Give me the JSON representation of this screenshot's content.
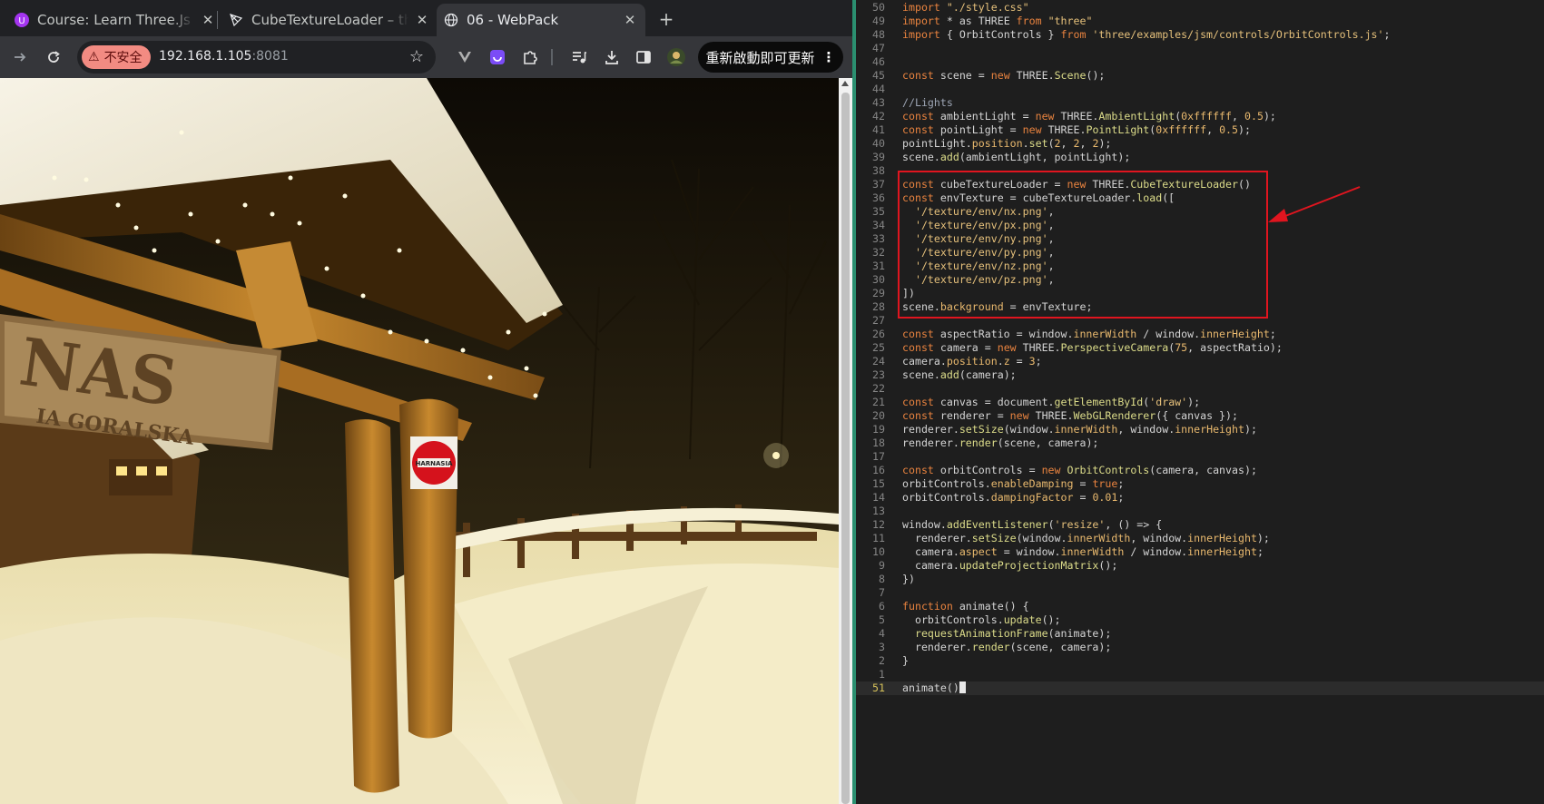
{
  "browser": {
    "tabs": [
      {
        "title": "Course: Learn Three.Js a",
        "icon": "udemy-icon",
        "active": false
      },
      {
        "title": "CubeTextureLoader – thr",
        "icon": "threejs-icon",
        "active": false
      },
      {
        "title": "06 - WebPack",
        "icon": "globe-icon",
        "active": true
      }
    ],
    "security_label": "不安全",
    "url_host": "192.168.1.105",
    "url_port": ":8081",
    "update_button": "重新啟動即可更新"
  },
  "page": {
    "sign_text": "HARNASIA",
    "board_text": "NAS",
    "board_subtext": "IA GORALSKA"
  },
  "editor": {
    "highlight_color": "#e0151f",
    "lines": [
      {
        "n": "50",
        "t": "import \"./style.css\""
      },
      {
        "n": "49",
        "t": "import * as THREE from \"three\""
      },
      {
        "n": "48",
        "t": "import { OrbitControls } from 'three/examples/jsm/controls/OrbitControls.js';"
      },
      {
        "n": "47",
        "t": ""
      },
      {
        "n": "46",
        "t": ""
      },
      {
        "n": "45",
        "t": "const scene = new THREE.Scene();"
      },
      {
        "n": "44",
        "t": ""
      },
      {
        "n": "43",
        "t": "//Lights"
      },
      {
        "n": "42",
        "t": "const ambientLight = new THREE.AmbientLight(0xffffff, 0.5);"
      },
      {
        "n": "41",
        "t": "const pointLight = new THREE.PointLight(0xffffff, 0.5);"
      },
      {
        "n": "40",
        "t": "pointLight.position.set(2, 2, 2);"
      },
      {
        "n": "39",
        "t": "scene.add(ambientLight, pointLight);"
      },
      {
        "n": "38",
        "t": ""
      },
      {
        "n": "37",
        "t": "const cubeTextureLoader = new THREE.CubeTextureLoader()"
      },
      {
        "n": "36",
        "t": "const envTexture = cubeTextureLoader.load(["
      },
      {
        "n": "35",
        "t": "  '/texture/env/nx.png',"
      },
      {
        "n": "34",
        "t": "  '/texture/env/px.png',"
      },
      {
        "n": "33",
        "t": "  '/texture/env/ny.png',"
      },
      {
        "n": "32",
        "t": "  '/texture/env/py.png',"
      },
      {
        "n": "31",
        "t": "  '/texture/env/nz.png',"
      },
      {
        "n": "30",
        "t": "  '/texture/env/pz.png',"
      },
      {
        "n": "29",
        "t": "])"
      },
      {
        "n": "28",
        "t": "scene.background = envTexture;"
      },
      {
        "n": "27",
        "t": ""
      },
      {
        "n": "26",
        "t": "const aspectRatio = window.innerWidth / window.innerHeight;"
      },
      {
        "n": "25",
        "t": "const camera = new THREE.PerspectiveCamera(75, aspectRatio);"
      },
      {
        "n": "24",
        "t": "camera.position.z = 3;"
      },
      {
        "n": "23",
        "t": "scene.add(camera);"
      },
      {
        "n": "22",
        "t": ""
      },
      {
        "n": "21",
        "t": "const canvas = document.getElementById('draw');"
      },
      {
        "n": "20",
        "t": "const renderer = new THREE.WebGLRenderer({ canvas });"
      },
      {
        "n": "19",
        "t": "renderer.setSize(window.innerWidth, window.innerHeight);"
      },
      {
        "n": "18",
        "t": "renderer.render(scene, camera);"
      },
      {
        "n": "17",
        "t": ""
      },
      {
        "n": "16",
        "t": "const orbitControls = new OrbitControls(camera, canvas);"
      },
      {
        "n": "15",
        "t": "orbitControls.enableDamping = true;"
      },
      {
        "n": "14",
        "t": "orbitControls.dampingFactor = 0.01;"
      },
      {
        "n": "13",
        "t": ""
      },
      {
        "n": "12",
        "t": "window.addEventListener('resize', () => {"
      },
      {
        "n": "11",
        "t": "  renderer.setSize(window.innerWidth, window.innerHeight);"
      },
      {
        "n": "10",
        "t": "  camera.aspect = window.innerWidth / window.innerHeight;"
      },
      {
        "n": "9",
        "t": "  camera.updateProjectionMatrix();"
      },
      {
        "n": "8",
        "t": "})"
      },
      {
        "n": "7",
        "t": ""
      },
      {
        "n": "6",
        "t": "function animate() {"
      },
      {
        "n": "5",
        "t": "  orbitControls.update();"
      },
      {
        "n": "4",
        "t": "  requestAnimationFrame(animate);"
      },
      {
        "n": "3",
        "t": "  renderer.render(scene, camera);"
      },
      {
        "n": "2",
        "t": "}"
      },
      {
        "n": "1",
        "t": ""
      },
      {
        "n": "51",
        "t": "animate();",
        "current": true
      }
    ]
  }
}
